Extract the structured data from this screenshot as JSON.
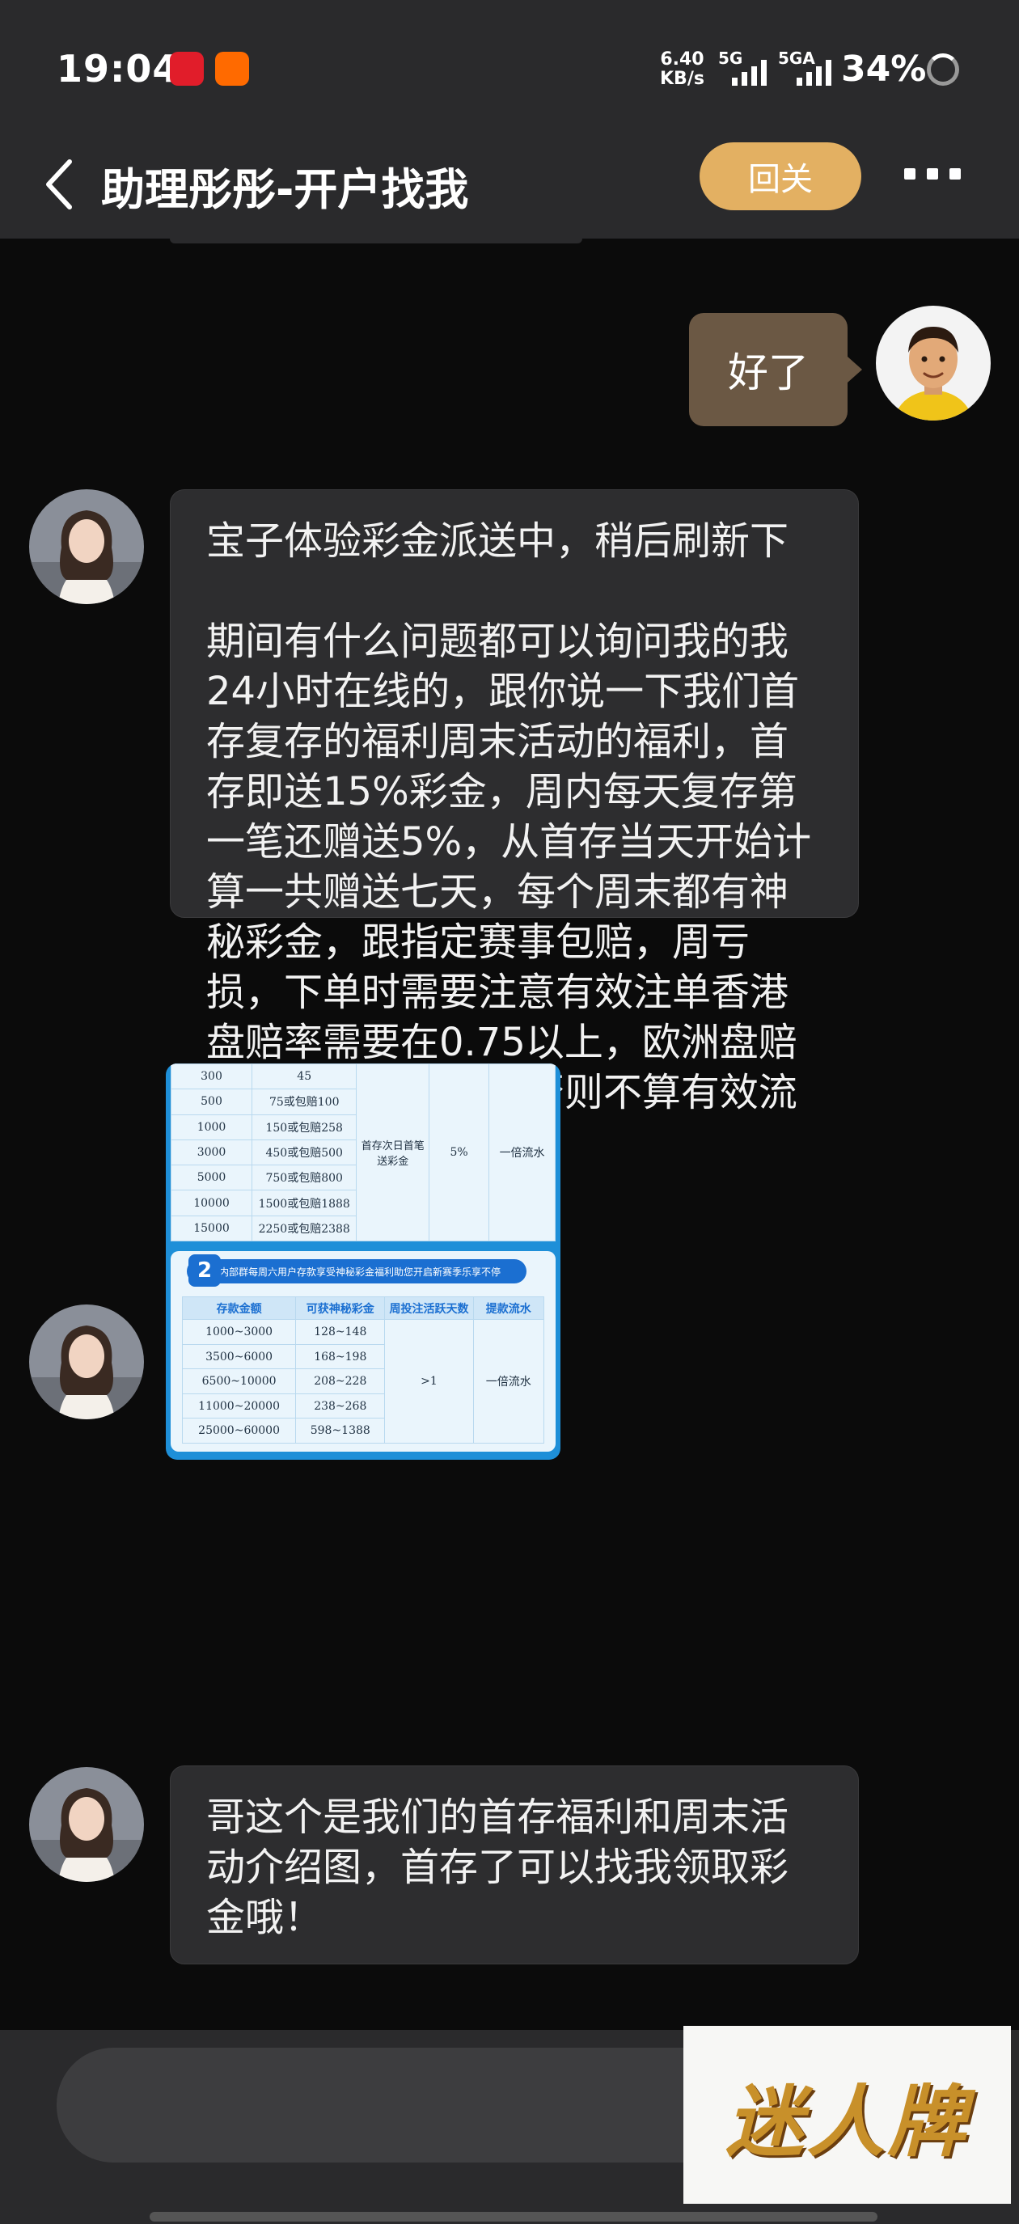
{
  "status_bar": {
    "time": "19:04",
    "net_speed_value": "6.40",
    "net_speed_unit": "KB/s",
    "signal1": "5G",
    "signal2": "5GA",
    "battery": "34%"
  },
  "header": {
    "title": "助理彤彤-开户找我",
    "follow_button": "回关"
  },
  "messages": [
    {
      "from": "me",
      "text": "好了"
    },
    {
      "from": "assistant",
      "text": "宝子体验彩金派送中，稍后刷新下\n\n期间有什么问题都可以询问我的我24小时在线的，跟你说一下我们首存复存的福利周末活动的福利，首存即送15%彩金，周内每天复存第一笔还赠送5%，从首存当天开始计算一共赠送七天，每个周末都有神秘彩金，跟指定赛事包赔，周亏损，下单时需要注意有效注单香港盘赔率需要在0.75以上，欧洲盘赔率需要在1.75以上否则不算有效流水哦"
    },
    {
      "from": "assistant",
      "type": "image"
    },
    {
      "from": "assistant",
      "text": "哥这个是我们的首存福利和周末活动介绍图，首存了可以找我领取彩金哦！"
    }
  ],
  "promo_image": {
    "table1": {
      "rows": [
        [
          "300",
          "45"
        ],
        [
          "500",
          "75或包赔100"
        ],
        [
          "1000",
          "150或包赔258"
        ],
        [
          "3000",
          "450或包赔500"
        ],
        [
          "5000",
          "750或包赔800"
        ],
        [
          "10000",
          "1500或包赔1888"
        ],
        [
          "15000",
          "2250或包赔2388"
        ]
      ],
      "merged_label": "首存次日首笔送彩金",
      "merged_percent": "5%",
      "merged_flow": "一倍流水"
    },
    "section2": {
      "badge": "2",
      "banner": "内部群每周六用户存款享受神秘彩金福利助您开启新赛季乐享不停",
      "headers": [
        "存款金额",
        "可获神秘彩金",
        "周投注活跃天数",
        "提款流水"
      ],
      "rows": [
        [
          "1000~3000",
          "128~148"
        ],
        [
          "3500~6000",
          "168~198"
        ],
        [
          "6500~10000",
          "208~228"
        ],
        [
          "11000~20000",
          "238~268"
        ],
        [
          "25000~60000",
          "598~1388"
        ]
      ],
      "active_days": ">1",
      "flow": "一倍流水"
    }
  },
  "input": {
    "placeholder": ""
  },
  "watermark": "迷人牌"
}
